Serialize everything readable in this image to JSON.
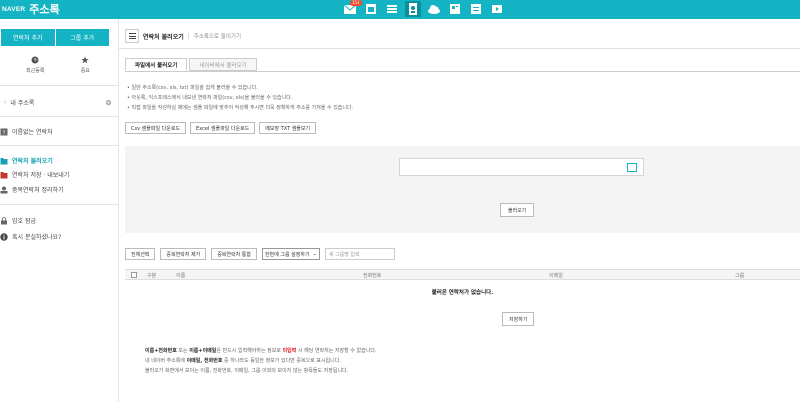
{
  "app": {
    "logo_text": "NAVER",
    "service_name": "주소록",
    "notification_count": "151"
  },
  "topbar": {
    "icons": [
      {
        "name": "mail-icon",
        "active": false
      },
      {
        "name": "calendar-icon",
        "active": false
      },
      {
        "name": "list-icon",
        "active": false
      },
      {
        "name": "contacts-icon",
        "active": true
      },
      {
        "name": "cloud-icon",
        "active": false
      },
      {
        "name": "memo-icon",
        "active": false
      },
      {
        "name": "note-icon",
        "active": false
      },
      {
        "name": "video-icon",
        "active": false
      }
    ]
  },
  "sidebar": {
    "add_contact": "연락처 추가",
    "add_group": "그룹 추가",
    "recent": "최근등록",
    "important": "중요",
    "my_addressbook": "내 주소록",
    "no_name": "이름없는 연락처",
    "import_contacts": "연락처 불러오기",
    "save_export": "연락처 저장 · 내보내기",
    "merge_duplicates": "중복연락처 정리하기",
    "encryption": "암호 잠금",
    "lost_question": "혹시 분실하셨나요?"
  },
  "header": {
    "title": "연락처 불러오기",
    "separator": "|",
    "subtitle": "주소록으로 들이기기"
  },
  "tabs": [
    {
      "label": "파일에서 불러오기",
      "active": true
    },
    {
      "label": "네이버에서 불러오기",
      "active": false
    }
  ],
  "notes": [
    "• 일반 주소록(csv, xls, txt) 파일을 쉽게 불러올 수 있습니다.",
    "• 아웃룩, 익스프레스에서 내보낸 연락처 파일(csv, xls)을 불러올 수 있습니다.",
    "• 직접 파일을 작성하실 때에는 샘플 파일에 맞추어 작성해 주시면 더욱 정확하게 주소를 가져올 수 있습니다."
  ],
  "downloads": {
    "csv": "Csv 샘플파일 다운로드",
    "excel": "Excel 샘플파일 다운로드",
    "txt": "메모장 TXT 샘플보기"
  },
  "upload": {
    "load_button": "불러오기"
  },
  "controls": {
    "select_all": "전체선택",
    "remove_duplicates": "중복연락처 제거",
    "merge_duplicates": "중복연락처 통합",
    "group_select": "한번에 그룹 설정하기",
    "group_input_placeholder": "새 그룹명 입력"
  },
  "table": {
    "headers": [
      "구분",
      "이름",
      "전화번호",
      "이메일",
      "그룹"
    ],
    "empty_message": "불러온 연락처가 없습니다."
  },
  "save_button": "저장하기",
  "footer": {
    "line1_a": "이름+전화번호",
    "line1_b": " 또는 ",
    "line1_c": "이름+이메일",
    "line1_d": "은 반드시 입력해야하는 정보로 ",
    "line1_e": "미입력",
    "line1_f": " 시 해당 연락처는 저장할 수 없습니다.",
    "line2_a": "내 네이버 주소록에 ",
    "line2_b": "이메일, 전화번호",
    "line2_c": " 중 하나라도 동일한 정보가 있다면 중복으로 표시됩니다.",
    "line3": "불러오기 화면에서 보이는 이름, 전화번호, 이메일, 그룹 이외의 보이지 않는 항목들도 저장됩니다."
  },
  "colors": {
    "accent": "#14b4c5",
    "alert": "#e01e1e",
    "badge": "#f24b2d"
  }
}
